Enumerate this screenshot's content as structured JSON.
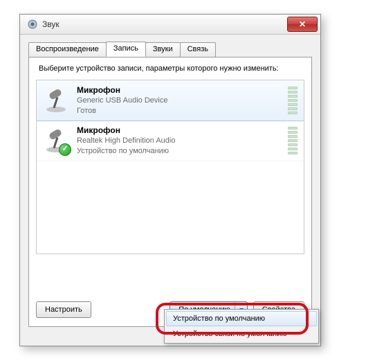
{
  "window": {
    "title": "Звук",
    "close_glyph": "✕"
  },
  "tabs": [
    {
      "label": "Воспроизведение"
    },
    {
      "label": "Запись"
    },
    {
      "label": "Звуки"
    },
    {
      "label": "Связь"
    }
  ],
  "active_tab_index": 1,
  "instruction": "Выберите устройство записи, параметры которого нужно изменить:",
  "devices": [
    {
      "name": "Микрофон",
      "desc": "Generic USB Audio Device",
      "status": "Готов",
      "default": false,
      "selected": true
    },
    {
      "name": "Микрофон",
      "desc": "Realtek High Definition Audio",
      "status": "Устройство по умолчанию",
      "default": true,
      "selected": false
    }
  ],
  "buttons": {
    "configure": "Настроить",
    "set_default": "По умолчанию",
    "properties": "Свойства"
  },
  "dropdown": {
    "items": [
      "Устройство по умолчанию",
      "Устройство связи по умолчанию"
    ],
    "highlighted_index": 0
  }
}
